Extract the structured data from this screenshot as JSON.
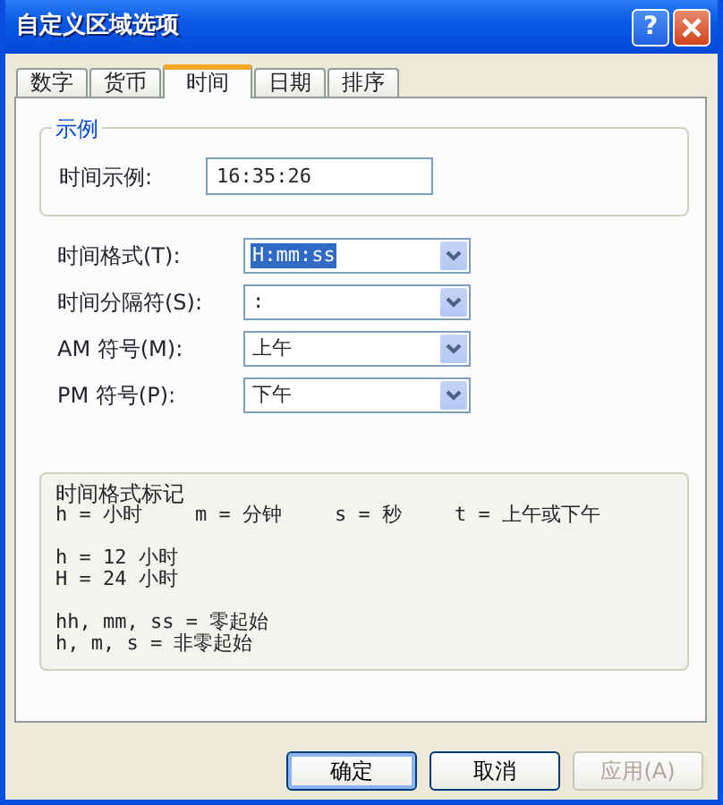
{
  "window": {
    "title": "自定义区域选项",
    "help_glyph": "?"
  },
  "tabs": [
    {
      "label": "数字",
      "selected": false
    },
    {
      "label": "货币",
      "selected": false
    },
    {
      "label": "时间",
      "selected": true
    },
    {
      "label": "日期",
      "selected": false
    },
    {
      "label": "排序",
      "selected": false
    }
  ],
  "sample": {
    "title": "示例",
    "label": "时间示例:",
    "value": "16:35:26"
  },
  "settings": [
    {
      "label": "时间格式(T):",
      "value": "H:mm:ss",
      "focused": true
    },
    {
      "label": "时间分隔符(S):",
      "value": ":",
      "focused": false
    },
    {
      "label": "AM 符号(M):",
      "value": "上午",
      "focused": false
    },
    {
      "label": "PM 符号(P):",
      "value": "下午",
      "focused": false
    }
  ],
  "legend": {
    "title": "时间格式标记",
    "columns": [
      "h = 小时",
      "m = 分钟",
      "s = 秒",
      "t = 上午或下午"
    ],
    "groups": [
      [
        "h = 12 小时",
        "H = 24 小时"
      ],
      [
        "hh, mm, ss = 零起始",
        "h, m, s = 非零起始"
      ]
    ]
  },
  "buttons": [
    {
      "label": "确定",
      "default": true,
      "disabled": false
    },
    {
      "label": "取消",
      "default": false,
      "disabled": false
    },
    {
      "label": "应用(A)",
      "default": false,
      "disabled": true
    }
  ]
}
